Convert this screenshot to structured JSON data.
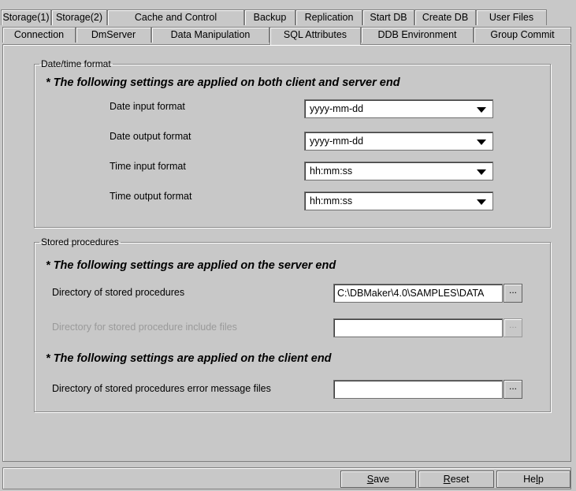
{
  "tabs_back": [
    "Storage(1)",
    "Storage(2)",
    "Cache and Control",
    "Backup",
    "Replication",
    "Start DB",
    "Create DB",
    "User Files"
  ],
  "tabs_front": [
    "Connection",
    "DmServer",
    "Data Manipulation",
    "SQL Attributes",
    "DDB Environment",
    "Group Commit"
  ],
  "active_tab": "SQL Attributes",
  "datetime_group": {
    "legend": "Date/time format",
    "heading": "* The following settings are applied on both client and server end",
    "rows": [
      {
        "label": "Date input format",
        "value": "yyyy-mm-dd"
      },
      {
        "label": "Date output format",
        "value": "yyyy-mm-dd"
      },
      {
        "label": "Time input format",
        "value": "hh:mm:ss"
      },
      {
        "label": "Time output format",
        "value": "hh:mm:ss"
      }
    ]
  },
  "sp_group": {
    "legend": "Stored procedures",
    "server_heading": "* The following settings are applied on the server end",
    "dir_label": "Directory of stored procedures",
    "dir_value": "C:\\DBMaker\\4.0\\SAMPLES\\DATA",
    "include_label": "Directory for stored procedure include files",
    "include_value": "",
    "client_heading": "* The following settings are applied on the client end",
    "err_label": "Directory of stored procedures error message files",
    "err_value": "",
    "browse_label": "..."
  },
  "buttons": {
    "save_prefix": "",
    "save_underline": "S",
    "save_rest": "ave",
    "reset_underline": "R",
    "reset_rest": "eset",
    "help_rest1": "He",
    "help_underline": "l",
    "help_rest2": "p"
  }
}
